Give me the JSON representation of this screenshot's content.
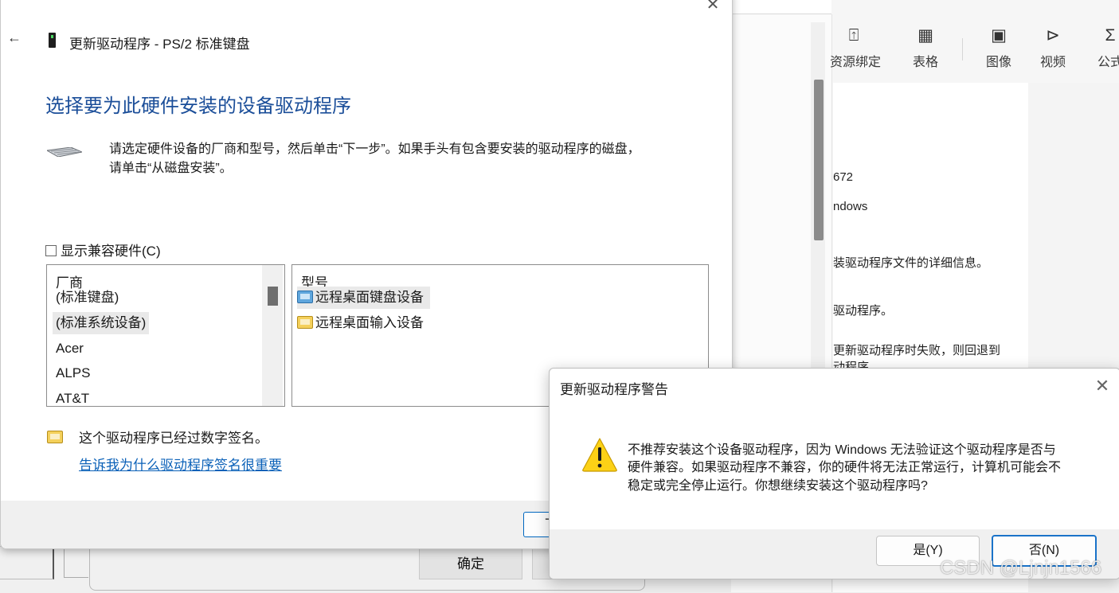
{
  "editor": {
    "toolbar": [
      {
        "icon": "upload-box-icon",
        "label": "资源绑定"
      },
      {
        "icon": "table-icon",
        "label": "表格"
      },
      {
        "icon": "image-icon",
        "label": "图像"
      },
      {
        "icon": "video-icon",
        "label": "视频"
      },
      {
        "icon": "sigma-icon",
        "label": "公式"
      }
    ],
    "doc_lines": [
      "672",
      "ndows",
      "装驱动程序文件的详细信息。",
      "驱动程序。",
      "更新驱动程序时失败，则回退到",
      "动程序。"
    ]
  },
  "behind": {
    "ok_label": "确定"
  },
  "wizard": {
    "title": "更新驱动程序 - PS/2 标准键盘",
    "heading": "选择要为此硬件安装的设备驱动程序",
    "desc_line1": "请选定硬件设备的厂商和型号，然后单击“下一步”。如果手头有包含要安装的驱动程序的磁盘，",
    "desc_line2": "请单击“从磁盘安装”。",
    "compat_label": "显示兼容硬件(C)",
    "manufacturer_header": "厂商",
    "manufacturers": [
      "(标准键盘)",
      "(标准系统设备)",
      "Acer",
      "ALPS",
      "AT&T"
    ],
    "selected_manufacturer": "(标准系统设备)",
    "model_header": "型号",
    "models": [
      "远程桌面键盘设备",
      "远程桌面输入设备"
    ],
    "selected_model": "远程桌面键盘设备",
    "signed_text": "这个驱动程序已经过数字签名。",
    "signed_link": "告诉我为什么驱动程序签名很重要",
    "next_partial": "下"
  },
  "warning": {
    "title": "更新驱动程序警告",
    "message_lines": [
      "不推荐安装这个设备驱动程序，因为 Windows 无法验证这个驱动程序是否与",
      "硬件兼容。如果驱动程序不兼容，你的硬件将无法正常运行，计算机可能会不",
      "稳定或完全停止运行。你想继续安装这个驱动程序吗?"
    ],
    "yes_label": "是(Y)",
    "no_label": "否(N)"
  },
  "watermark": "CSDN @Ljnjn1566"
}
